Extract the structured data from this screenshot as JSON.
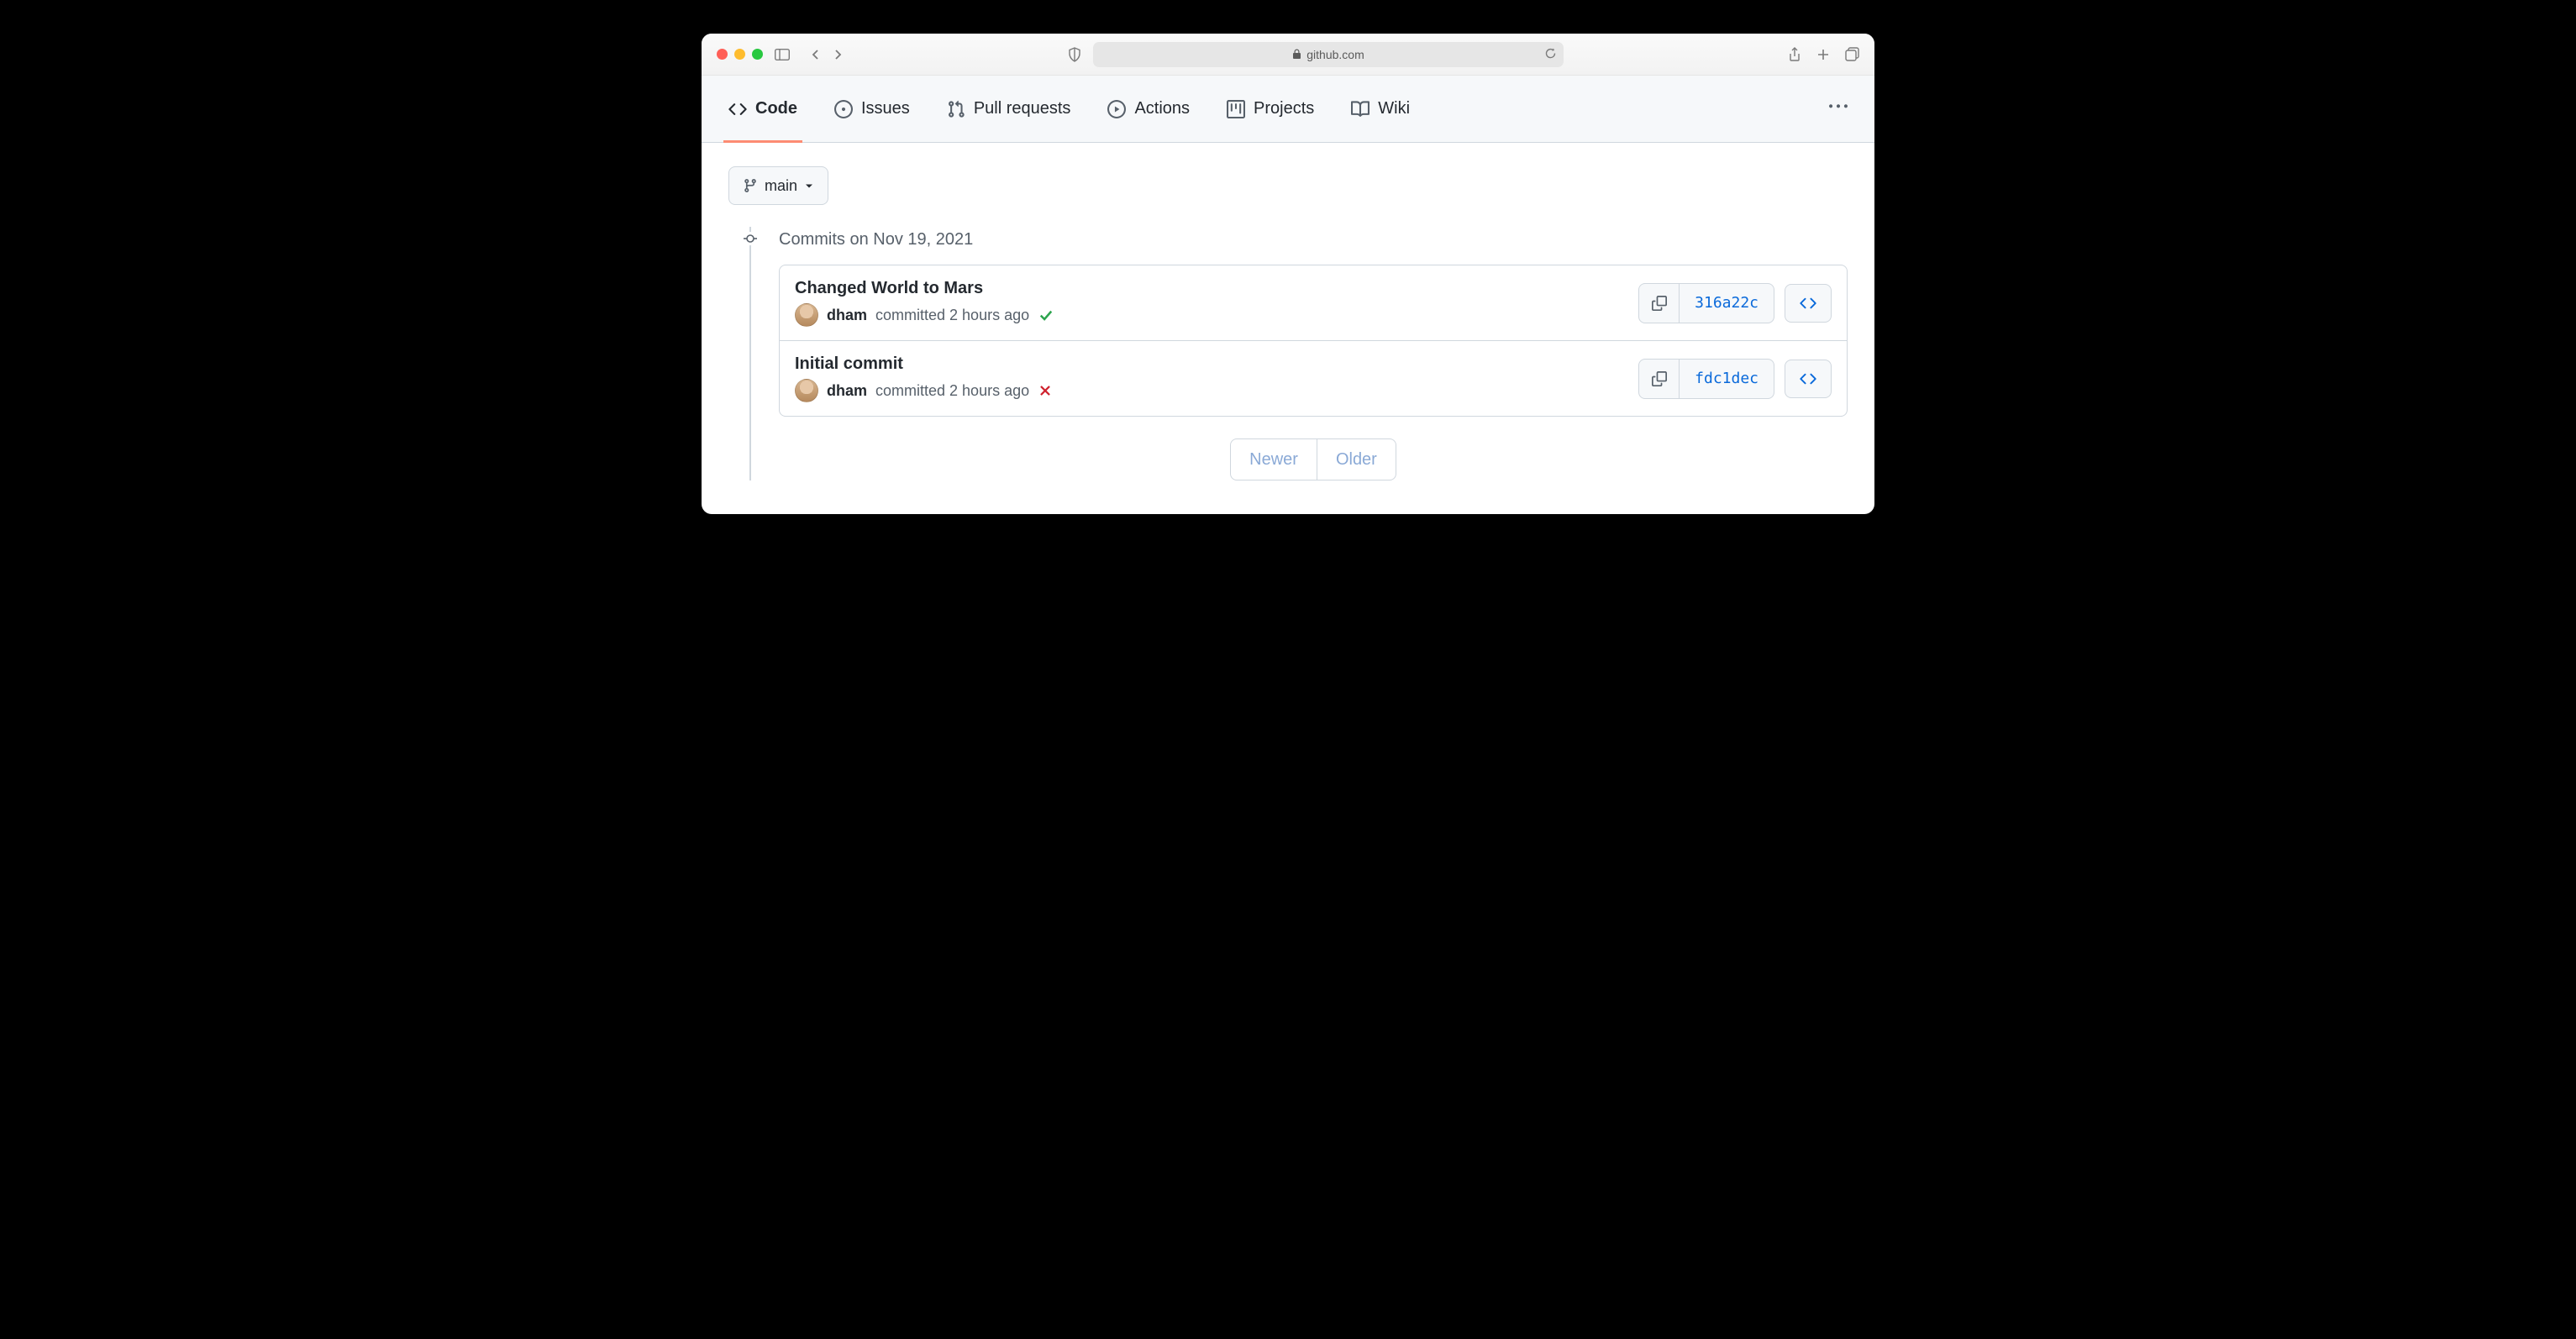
{
  "browser": {
    "domain": "github.com"
  },
  "nav": {
    "code": "Code",
    "issues": "Issues",
    "pulls": "Pull requests",
    "actions": "Actions",
    "projects": "Projects",
    "wiki": "Wiki"
  },
  "branch": "main",
  "group_title": "Commits on Nov 19, 2021",
  "commits": [
    {
      "title": "Changed World to Mars",
      "author": "dham",
      "meta": "committed 2 hours ago",
      "status": "success",
      "sha": "316a22c"
    },
    {
      "title": "Initial commit",
      "author": "dham",
      "meta": "committed 2 hours ago",
      "status": "failure",
      "sha": "fdc1dec"
    }
  ],
  "pager": {
    "newer": "Newer",
    "older": "Older"
  }
}
